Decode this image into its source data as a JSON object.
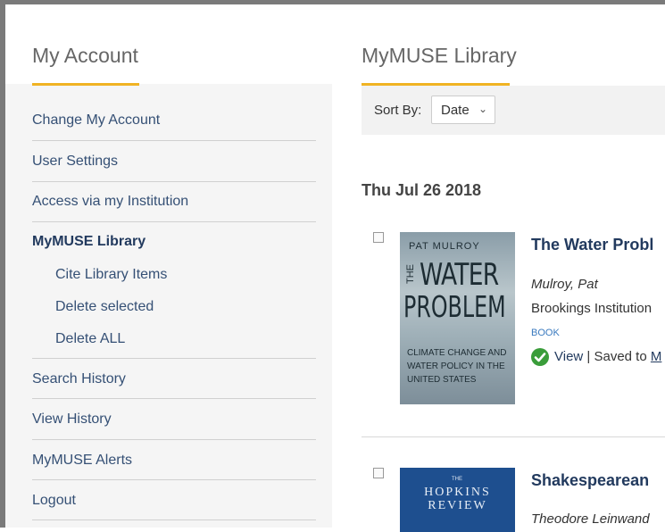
{
  "sidebar": {
    "title": "My Account",
    "items": [
      {
        "label": "Change My Account"
      },
      {
        "label": "User Settings"
      },
      {
        "label": "Access via my Institution"
      },
      {
        "label": "MyMUSE Library",
        "active": true
      },
      {
        "label": "Search History"
      },
      {
        "label": "View History"
      },
      {
        "label": "MyMUSE Alerts"
      },
      {
        "label": "Logout"
      }
    ],
    "subitems": [
      {
        "label": "Cite Library Items"
      },
      {
        "label": "Delete selected"
      },
      {
        "label": "Delete ALL"
      }
    ]
  },
  "main": {
    "title": "MyMUSE Library",
    "sort_label": "Sort By:",
    "sort_value": "Date",
    "date_heading": "Thu Jul 26 2018",
    "items": [
      {
        "title": "The Water Probl",
        "author": "Mulroy, Pat",
        "publisher": "Brookings Institution",
        "type": "BOOK",
        "view": "View",
        "sep": " | ",
        "saved": "Saved to ",
        "saved_link": "M",
        "cover": {
          "author": "PAT MULROY",
          "the": "THE",
          "water": "WATER",
          "problem": "PROBLEM",
          "subtitle": "CLIMATE CHANGE AND WATER POLICY IN THE UNITED STATES"
        }
      },
      {
        "title": "Shakespearean",
        "author": "Theodore Leinwand",
        "cover": {
          "small": "THE",
          "line1": "HOPKINS",
          "line2": "REVIEW"
        }
      }
    ]
  },
  "colors": {
    "accent": "#f0b323",
    "link": "#355075",
    "check": "#3a9d3a",
    "type": "#3a7abf"
  }
}
